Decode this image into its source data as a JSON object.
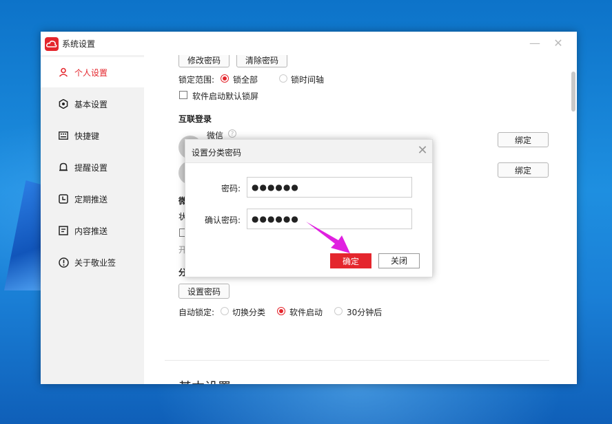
{
  "window": {
    "title": "系统设置",
    "minimize_icon": "minimize-icon",
    "close_icon": "close-icon"
  },
  "sidebar": {
    "items": [
      {
        "label": "个人设置",
        "icon": "user-icon",
        "active": true
      },
      {
        "label": "基本设置",
        "icon": "settings-icon",
        "active": false
      },
      {
        "label": "快捷键",
        "icon": "keyboard-icon",
        "active": false
      },
      {
        "label": "提醒设置",
        "icon": "bell-icon",
        "active": false
      },
      {
        "label": "定期推送",
        "icon": "clock-icon",
        "active": false
      },
      {
        "label": "内容推送",
        "icon": "document-icon",
        "active": false
      },
      {
        "label": "关于敬业签",
        "icon": "info-icon",
        "active": false
      }
    ]
  },
  "content": {
    "change_password_btn": "修改密码",
    "clear_password_btn": "清除密码",
    "lock_scope_label": "锁定范围:",
    "lock_all": "锁全部",
    "lock_timeline": "锁时间轴",
    "lock_on_startup": "软件启动默认锁屏",
    "connect_login_title": "互联登录",
    "wechat_label": "微信",
    "help_icon": "help-icon",
    "bind_btn": "绑定",
    "bind_btn2": "绑定",
    "partial_wechat": "微",
    "partial_status": "状",
    "partial_open": "开",
    "partial_category": "分",
    "set_password_btn": "设置密码",
    "auto_lock_label": "自动锁定:",
    "auto_lock_switch": "切换分类",
    "auto_lock_startup": "软件启动",
    "auto_lock_30min": "30分钟后",
    "section_basic": "基本设置"
  },
  "dialog": {
    "title": "设置分类密码",
    "password_label": "密码:",
    "password_value": "●●●●●●",
    "confirm_label": "确认密码:",
    "confirm_value": "●●●●●●",
    "ok_btn": "确定",
    "cancel_btn": "关闭"
  },
  "colors": {
    "accent": "#e4262d",
    "sidebar_bg": "#f2f2f2",
    "arrow": "#e020e0"
  }
}
